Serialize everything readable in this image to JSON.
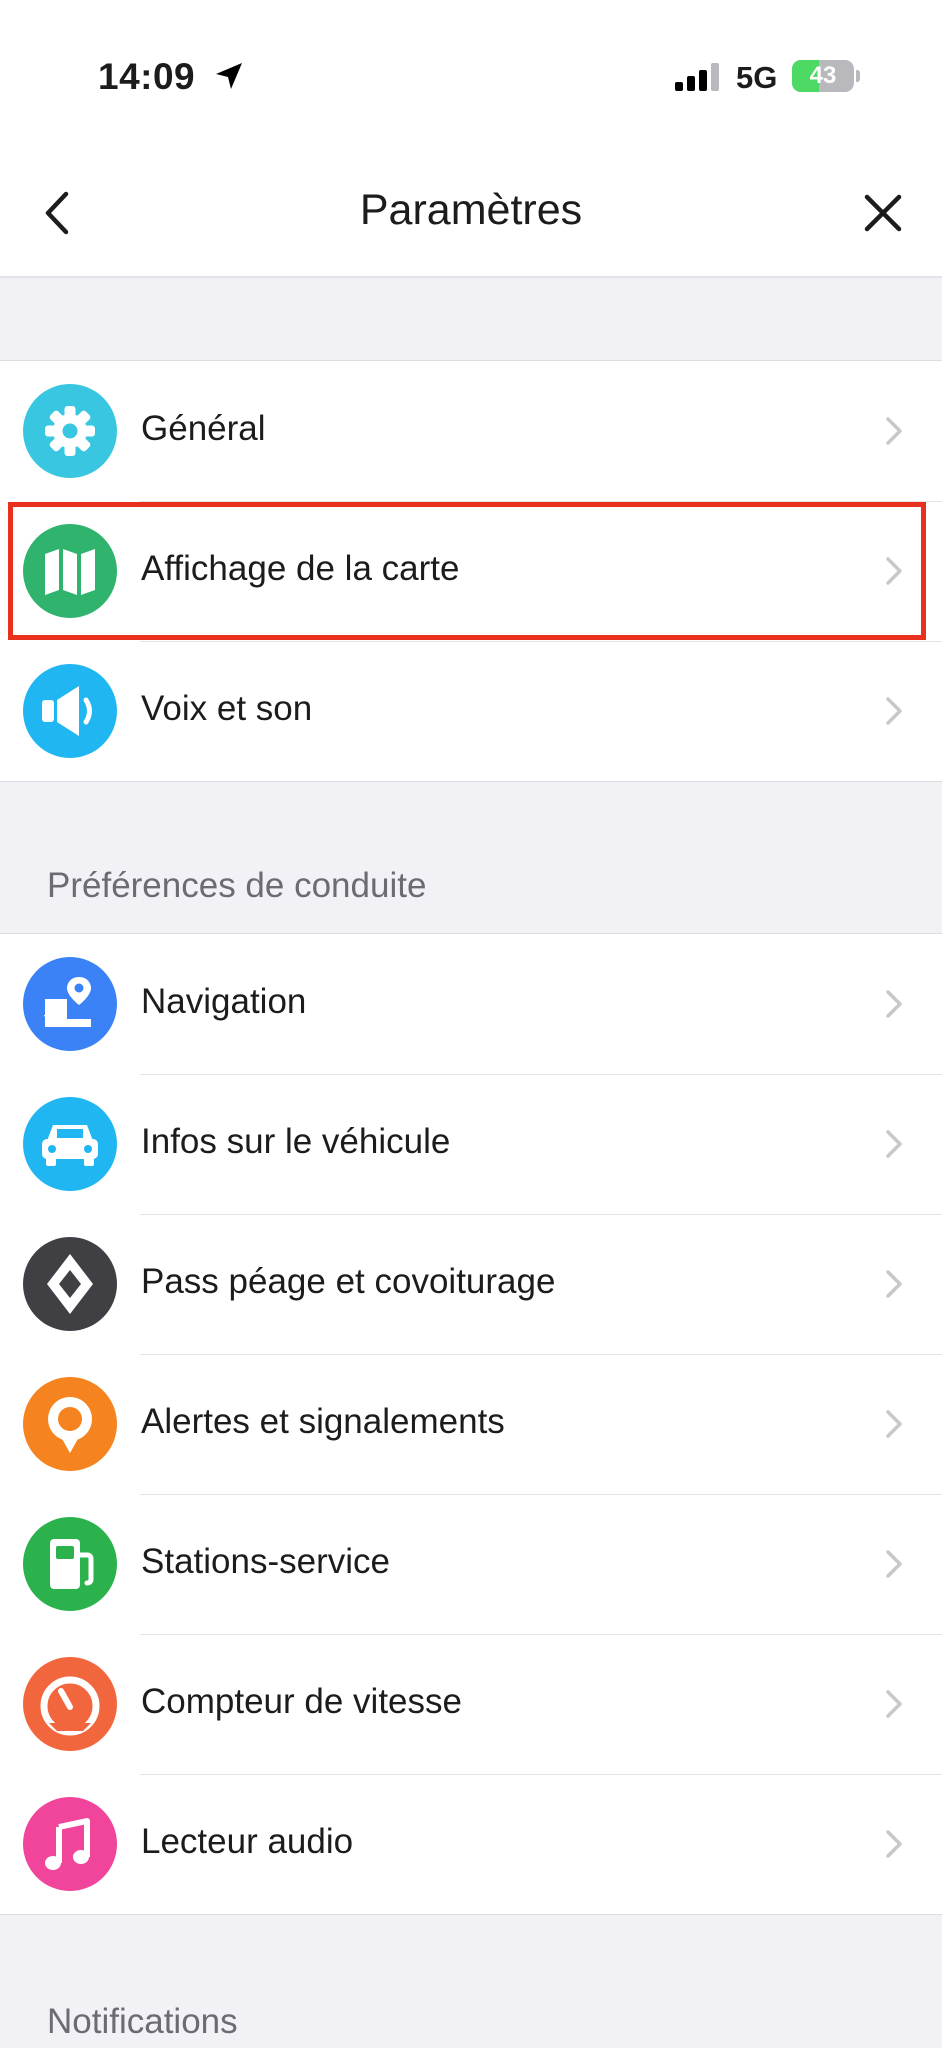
{
  "status_bar": {
    "time": "14:09",
    "network": "5G",
    "battery_level": "43",
    "battery_fraction": 0.43
  },
  "nav": {
    "title": "Paramètres",
    "back_icon": "chevron-left-icon",
    "close_icon": "close-icon"
  },
  "sections": [
    {
      "header": "",
      "items": [
        {
          "label": "Général",
          "icon": "gear-icon",
          "color": "#38c6e0"
        },
        {
          "label": "Affichage de la carte",
          "icon": "map-icon",
          "color": "#2fb36d"
        },
        {
          "label": "Voix et son",
          "icon": "speaker-icon",
          "color": "#1fb6f2"
        }
      ]
    },
    {
      "header": "Préférences de conduite",
      "items": [
        {
          "label": "Navigation",
          "icon": "navigation-icon",
          "color": "#3b82f6"
        },
        {
          "label": "Infos sur le véhicule",
          "icon": "car-icon",
          "color": "#1fb6f2"
        },
        {
          "label": "Pass péage et covoiturage",
          "icon": "toll-pass-icon",
          "color": "#3f3f44"
        },
        {
          "label": "Alertes et signalements",
          "icon": "alert-pin-icon",
          "color": "#f5831f"
        },
        {
          "label": "Stations-service",
          "icon": "fuel-icon",
          "color": "#2bb24c"
        },
        {
          "label": "Compteur de vitesse",
          "icon": "speedometer-icon",
          "color": "#f2663e"
        },
        {
          "label": "Lecteur audio",
          "icon": "music-icon",
          "color": "#f0459a"
        }
      ]
    },
    {
      "header": "Notifications",
      "items": []
    }
  ],
  "highlight_color": "#e8301c"
}
